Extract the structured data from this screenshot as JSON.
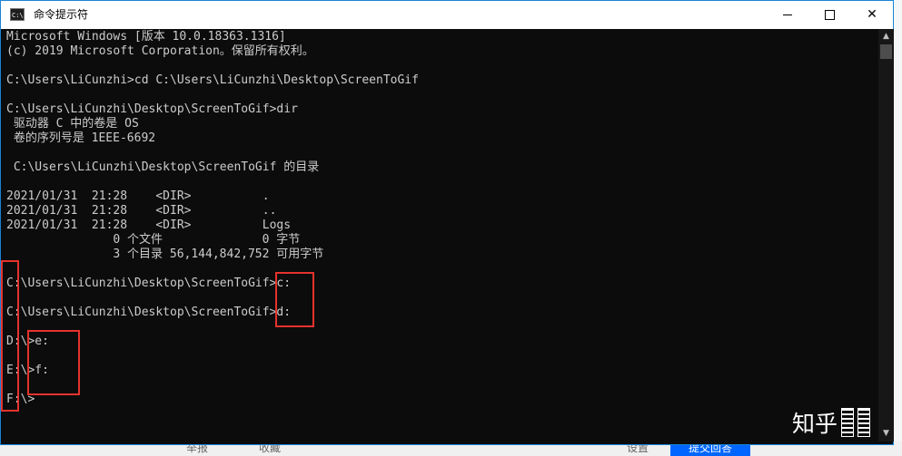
{
  "window": {
    "title": "命令提示符",
    "icon_label": "C:\\",
    "controls": {
      "minimize": "minimize-icon",
      "maximize": "maximize-icon",
      "close": "close-icon"
    }
  },
  "console": {
    "lines": [
      "Microsoft Windows [版本 10.0.18363.1316]",
      "(c) 2019 Microsoft Corporation。保留所有权利。",
      "",
      "C:\\Users\\LiCunzhi>cd C:\\Users\\LiCunzhi\\Desktop\\ScreenToGif",
      "",
      "C:\\Users\\LiCunzhi\\Desktop\\ScreenToGif>dir",
      " 驱动器 C 中的卷是 OS",
      " 卷的序列号是 1EEE-6692",
      "",
      " C:\\Users\\LiCunzhi\\Desktop\\ScreenToGif 的目录",
      "",
      "2021/01/31  21:28    <DIR>          .",
      "2021/01/31  21:28    <DIR>          ..",
      "2021/01/31  21:28    <DIR>          Logs",
      "               0 个文件              0 字节",
      "               3 个目录 56,144,842,752 可用字节",
      "",
      "C:\\Users\\LiCunzhi\\Desktop\\ScreenToGif>c:",
      "",
      "C:\\Users\\LiCunzhi\\Desktop\\ScreenToGif>d:",
      "",
      "D:\\>e:",
      "",
      "E:\\>f:",
      "",
      "F:\\>"
    ]
  },
  "watermark": {
    "text": "知乎"
  },
  "background": {
    "bottom_items": [
      "举报",
      "收藏",
      "设置",
      "提交回答"
    ]
  },
  "colors": {
    "console_bg": "#0c0c0c",
    "console_text": "#cccccc",
    "highlight_box": "#e5322d",
    "window_border": "#1883d7"
  }
}
